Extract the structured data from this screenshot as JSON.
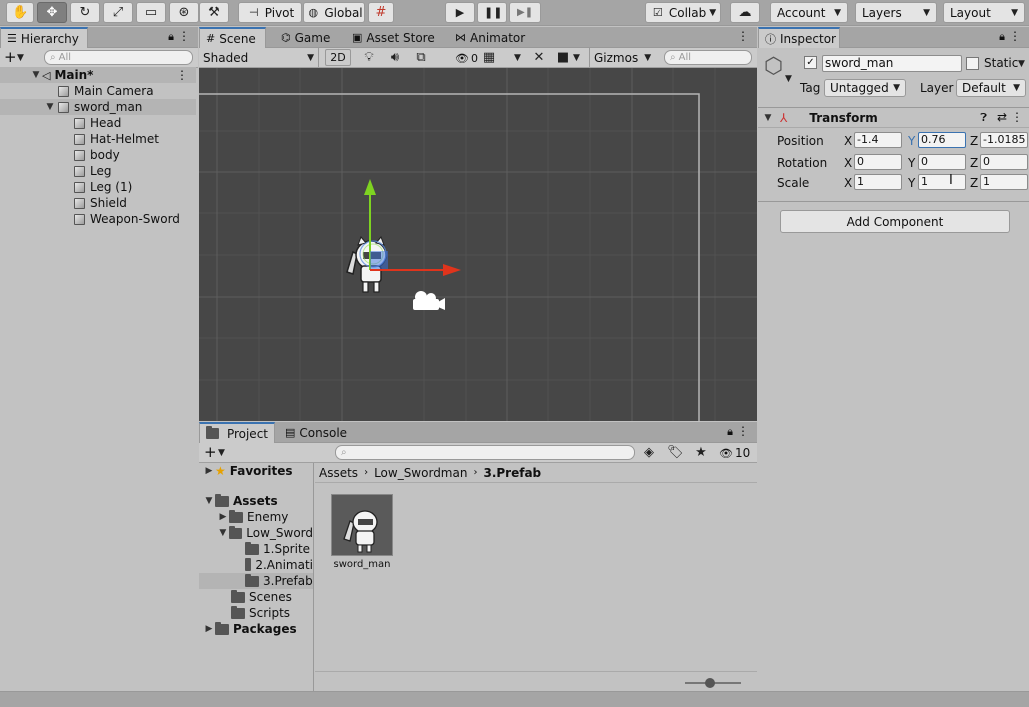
{
  "toolbar": {
    "tools": [
      {
        "icon": "hand-tool-icon"
      },
      {
        "icon": "move-tool-icon"
      },
      {
        "icon": "rotate-tool-icon"
      },
      {
        "icon": "scale-tool-icon"
      },
      {
        "icon": "rect-tool-icon"
      },
      {
        "icon": "transform-tool-icon"
      },
      {
        "icon": "custom-tool-icon"
      }
    ],
    "pivot_label": "Pivot",
    "global_label": "Global",
    "collab_label": "Collab",
    "account_label": "Account",
    "layers_label": "Layers",
    "layout_label": "Layout"
  },
  "hierarchy": {
    "tab_label": "Hierarchy",
    "search_placeholder": "All",
    "scene_name": "Main*",
    "items": [
      {
        "label": "Main Camera"
      },
      {
        "label": "sword_man"
      },
      {
        "label": "Head"
      },
      {
        "label": "Hat-Helmet"
      },
      {
        "label": "body"
      },
      {
        "label": "Leg"
      },
      {
        "label": "Leg (1)"
      },
      {
        "label": "Shield"
      },
      {
        "label": "Weapon-Sword"
      }
    ]
  },
  "scene": {
    "tabs": [
      {
        "label": "Scene"
      },
      {
        "label": "Game"
      },
      {
        "label": "Asset Store"
      },
      {
        "label": "Animator"
      }
    ],
    "shading_mode": "Shaded",
    "mode_2d": "2D",
    "hidden_count": "0",
    "gizmos_label": "Gizmos",
    "search_placeholder": "All"
  },
  "project": {
    "tabs": [
      {
        "label": "Project"
      },
      {
        "label": "Console"
      }
    ],
    "hidden_count": "10",
    "favorites_label": "Favorites",
    "tree": [
      {
        "label": "Assets"
      },
      {
        "label": "Enemy"
      },
      {
        "label": "Low_Sword"
      },
      {
        "label": "1.Sprite"
      },
      {
        "label": "2.Animati"
      },
      {
        "label": "3.Prefab"
      },
      {
        "label": "Scenes"
      },
      {
        "label": "Scripts"
      },
      {
        "label": "Packages"
      }
    ],
    "breadcrumb": [
      "Assets",
      "Low_Swordman",
      "3.Prefab"
    ],
    "asset_name": "sword_man",
    "zoom_level": 0.45
  },
  "inspector": {
    "tab_label": "Inspector",
    "object_name": "sword_man",
    "static_label": "Static",
    "tag_label": "Tag",
    "tag_value": "Untagged",
    "layer_label": "Layer",
    "layer_value": "Default",
    "component_title": "Transform",
    "position_label": "Position",
    "rotation_label": "Rotation",
    "scale_label": "Scale",
    "axis_x": "X",
    "axis_y": "Y",
    "axis_z": "Z",
    "position": {
      "x": "-1.4",
      "y": "0.76",
      "z": "-1.0185"
    },
    "rotation": {
      "x": "0",
      "y": "0",
      "z": "0"
    },
    "scale": {
      "x": "1",
      "y": "1",
      "z": "1"
    },
    "add_component_label": "Add Component"
  },
  "colors": {
    "accent": "#3a72b0",
    "scene_bg": "#474747",
    "gizmo_x": "#e0341c",
    "gizmo_y": "#7ed321"
  }
}
